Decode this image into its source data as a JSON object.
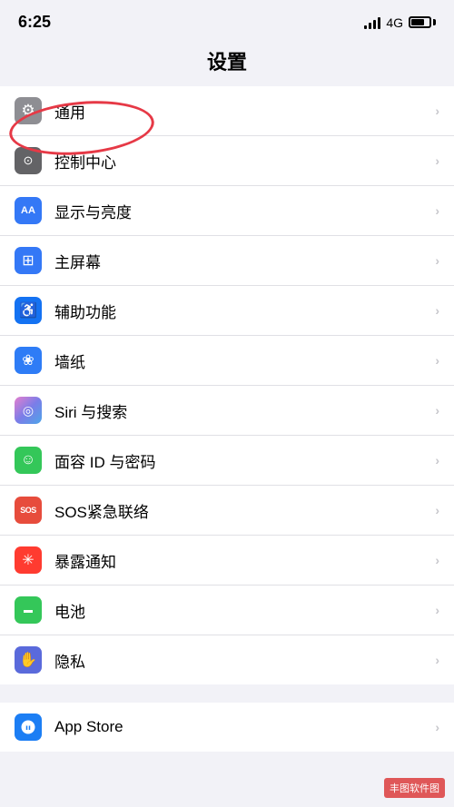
{
  "statusBar": {
    "time": "6:25",
    "network": "4G"
  },
  "navTitle": "设置",
  "settings": {
    "items": [
      {
        "id": "general",
        "label": "通用",
        "iconClass": "icon-general",
        "iconSymbol": "⚙"
      },
      {
        "id": "control-center",
        "label": "控制中心",
        "iconClass": "icon-control",
        "iconSymbol": "⊙"
      },
      {
        "id": "display",
        "label": "显示与亮度",
        "iconClass": "icon-display",
        "iconSymbol": "AA"
      },
      {
        "id": "homescreen",
        "label": "主屏幕",
        "iconClass": "icon-homescreen",
        "iconSymbol": "⊞"
      },
      {
        "id": "accessibility",
        "label": "辅助功能",
        "iconClass": "icon-accessibility",
        "iconSymbol": "♿"
      },
      {
        "id": "wallpaper",
        "label": "墙纸",
        "iconClass": "icon-wallpaper",
        "iconSymbol": "❀"
      },
      {
        "id": "siri",
        "label": "Siri 与搜索",
        "iconClass": "icon-siri",
        "iconSymbol": "◎"
      },
      {
        "id": "faceid",
        "label": "面容 ID 与密码",
        "iconClass": "icon-faceid",
        "iconSymbol": "☺"
      },
      {
        "id": "sos",
        "label": "SOS紧急联络",
        "iconClass": "icon-sos",
        "iconSymbol": "SOS"
      },
      {
        "id": "exposure",
        "label": "暴露通知",
        "iconClass": "icon-exposure",
        "iconSymbol": "✳"
      },
      {
        "id": "battery",
        "label": "电池",
        "iconClass": "icon-battery",
        "iconSymbol": "▬"
      },
      {
        "id": "privacy",
        "label": "隐私",
        "iconClass": "icon-privacy",
        "iconSymbol": "✋"
      },
      {
        "id": "appstore",
        "label": "App Store",
        "iconClass": "icon-appstore",
        "iconSymbol": "A"
      }
    ],
    "chevron": "›"
  },
  "watermark": "丰图软件图"
}
